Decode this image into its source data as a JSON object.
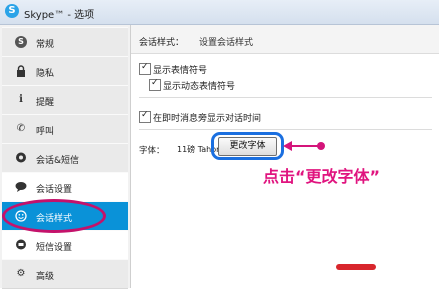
{
  "window": {
    "title": "Skype™ - 选项",
    "logo_letter": "S"
  },
  "sidebar": {
    "items": [
      {
        "label": "常规",
        "icon": "skype-icon",
        "glyph": "S"
      },
      {
        "label": "隐私",
        "icon": "lock-icon",
        "glyph": "🔒"
      },
      {
        "label": "提醒",
        "icon": "info-icon",
        "glyph": "i"
      },
      {
        "label": "呼叫",
        "icon": "phone-icon",
        "glyph": "✆"
      },
      {
        "label": "会话&短信",
        "icon": "chat-icon",
        "glyph": "💬"
      },
      {
        "label": "会话设置",
        "icon": "speech-bubble-icon",
        "glyph": "●"
      },
      {
        "label": "会话样式",
        "icon": "smile-icon",
        "glyph": "☺",
        "active": true
      },
      {
        "label": "短信设置",
        "icon": "sms-icon",
        "glyph": "●"
      },
      {
        "label": "高级",
        "icon": "gear-icon",
        "glyph": "⚙"
      }
    ]
  },
  "main": {
    "header_label": "会话样式：",
    "header_subtitle": "设置会话样式",
    "options": {
      "show_emoticons": {
        "label": "显示表情符号",
        "checked": true
      },
      "show_animated": {
        "label": "显示动态表情符号",
        "checked": true
      },
      "show_timestamps": {
        "label": "在即时消息旁显示对话时间",
        "checked": true
      }
    },
    "font": {
      "label": "字体：",
      "value": "11磅 Tahoma",
      "button_label": "更改字体"
    }
  },
  "annotation": {
    "text": "点击“更改字体”",
    "color": "#e0147f"
  },
  "colors": {
    "accent": "#0a92d8",
    "ring_blue": "#1a6fe0",
    "ellipse": "#c4126b"
  }
}
